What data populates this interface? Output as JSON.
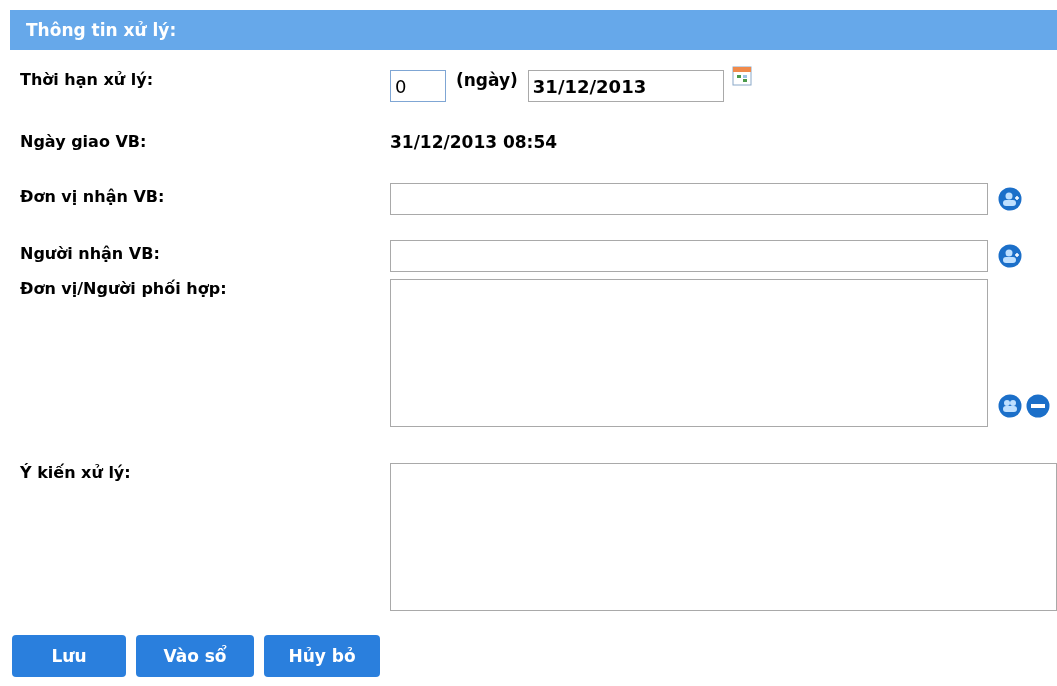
{
  "header": {
    "title": "Thông tin xử lý:"
  },
  "fields": [
    {
      "kind": "deadline",
      "label": "Thời hạn xử lý:",
      "days": "0",
      "unit": "(ngày)",
      "date": "31/12/2013"
    },
    {
      "kind": "text",
      "label": "Ngày giao VB:",
      "value": "31/12/2013 08:54"
    },
    {
      "kind": "picker",
      "label": "Đơn vị nhận VB:"
    },
    {
      "kind": "picker",
      "label": "Người nhận VB:"
    },
    {
      "kind": "list",
      "label": "Đơn vị/Người phối hợp:"
    },
    {
      "kind": "note",
      "label": "Ý kiến xử lý:"
    }
  ],
  "buttons": [
    "Lưu",
    "Vào sổ",
    "Hủy bỏ"
  ]
}
